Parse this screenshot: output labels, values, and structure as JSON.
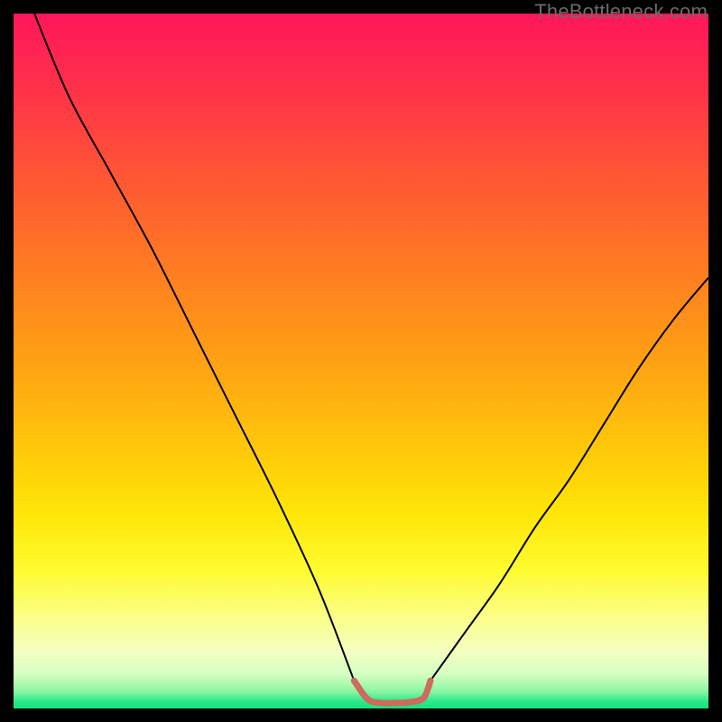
{
  "watermark": "TheBottleneck.com",
  "chart_data": {
    "type": "line",
    "title": "",
    "xlabel": "",
    "ylabel": "",
    "xlim": [
      0,
      100
    ],
    "ylim": [
      0,
      100
    ],
    "grid": false,
    "legend": false,
    "background_gradient_stops": [
      {
        "pos": 0,
        "color": "#ff165b"
      },
      {
        "pos": 10,
        "color": "#ff2f4a"
      },
      {
        "pos": 22,
        "color": "#ff5236"
      },
      {
        "pos": 36,
        "color": "#ff7a22"
      },
      {
        "pos": 50,
        "color": "#ffa114"
      },
      {
        "pos": 62,
        "color": "#ffc60a"
      },
      {
        "pos": 72,
        "color": "#ffe607"
      },
      {
        "pos": 80,
        "color": "#fffb2f"
      },
      {
        "pos": 87,
        "color": "#fbff8a"
      },
      {
        "pos": 92,
        "color": "#f2ffc2"
      },
      {
        "pos": 95,
        "color": "#d7ffc3"
      },
      {
        "pos": 97.5,
        "color": "#8df6a1"
      },
      {
        "pos": 99,
        "color": "#28e98a"
      },
      {
        "pos": 100,
        "color": "#14e57c"
      }
    ],
    "series": [
      {
        "name": "left-descent",
        "stroke": "#000000",
        "stroke_width": 2,
        "x": [
          3,
          8,
          14,
          20,
          26,
          32,
          38,
          44,
          49
        ],
        "y": [
          100,
          88,
          77,
          66,
          54,
          42,
          30,
          17,
          4
        ]
      },
      {
        "name": "valley-floor",
        "stroke": "#cf6a5e",
        "stroke_width": 7,
        "x": [
          49,
          51,
          53,
          55,
          57,
          59,
          60
        ],
        "y": [
          4,
          1.3,
          0.8,
          0.8,
          0.9,
          1.5,
          4
        ]
      },
      {
        "name": "right-ascent",
        "stroke": "#000000",
        "stroke_width": 2,
        "x": [
          60,
          65,
          70,
          75,
          80,
          85,
          90,
          95,
          100
        ],
        "y": [
          4,
          11,
          18,
          26,
          33,
          41,
          49,
          56,
          62
        ]
      }
    ]
  }
}
